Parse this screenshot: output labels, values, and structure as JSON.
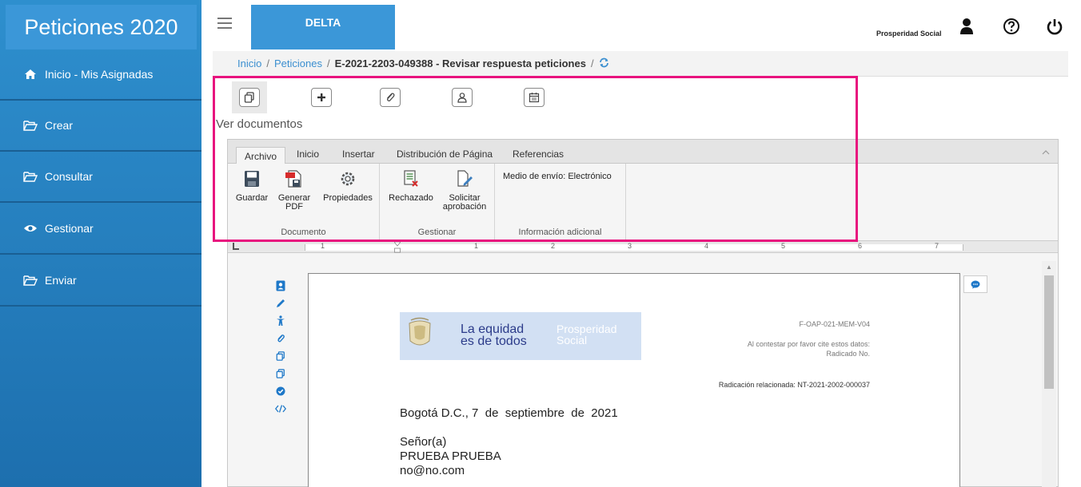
{
  "app": {
    "title": "Peticiones 2020",
    "module": "DELTA",
    "organization": "Prosperidad Social"
  },
  "sidebar": {
    "items": [
      {
        "label": "Inicio - Mis Asignadas",
        "icon": "home-icon"
      },
      {
        "label": "Crear",
        "icon": "folder-open-icon"
      },
      {
        "label": "Consultar",
        "icon": "folder-open-icon"
      },
      {
        "label": "Gestionar",
        "icon": "eye-icon"
      },
      {
        "label": "Enviar",
        "icon": "folder-open-icon"
      }
    ]
  },
  "breadcrumb": {
    "home": "Inicio",
    "section": "Peticiones",
    "current": "E-2021-2203-049388 - Revisar respuesta peticiones"
  },
  "section_title": "Ver documentos",
  "ribbon": {
    "tabs": [
      "Archivo",
      "Inicio",
      "Insertar",
      "Distribución de Página",
      "Referencias"
    ],
    "active_tab": "Archivo",
    "groups": {
      "documento": {
        "label": "Documento",
        "buttons": {
          "guardar": "Guardar",
          "generar_pdf_1": "Generar",
          "generar_pdf_2": "PDF",
          "propiedades": "Propiedades"
        }
      },
      "gestionar": {
        "label": "Gestionar",
        "buttons": {
          "rechazado": "Rechazado",
          "solicitar_1": "Solicitar",
          "solicitar_2": "aprobación"
        }
      },
      "info": {
        "label": "Información adicional",
        "medio_envio": "Medio de envío: Electrónico"
      }
    }
  },
  "ruler": {
    "numbers": [
      "1",
      "1",
      "2",
      "3",
      "4",
      "5",
      "6",
      "7"
    ]
  },
  "document": {
    "logo_line1": "La equidad",
    "logo_line2": "es de todos",
    "logo_brand1": "Prosperidad",
    "logo_brand2": "Social",
    "form_code": "F-OAP-021-MEM-V04",
    "cite_line1": "Al contestar por favor cite estos datos:",
    "cite_line2": "Radicado No.",
    "related": "Radicación relacionada: NT-2021-2002-000037",
    "date_line": "Bogotá D.C., 7  de  septiembre  de  2021",
    "salutation": "Señor(a)",
    "recipient": "PRUEBA PRUEBA",
    "email": "no@no.com"
  },
  "colors": {
    "sidebar": "#1d6fae",
    "accent": "#3b97d8",
    "highlight": "#e8137e"
  }
}
